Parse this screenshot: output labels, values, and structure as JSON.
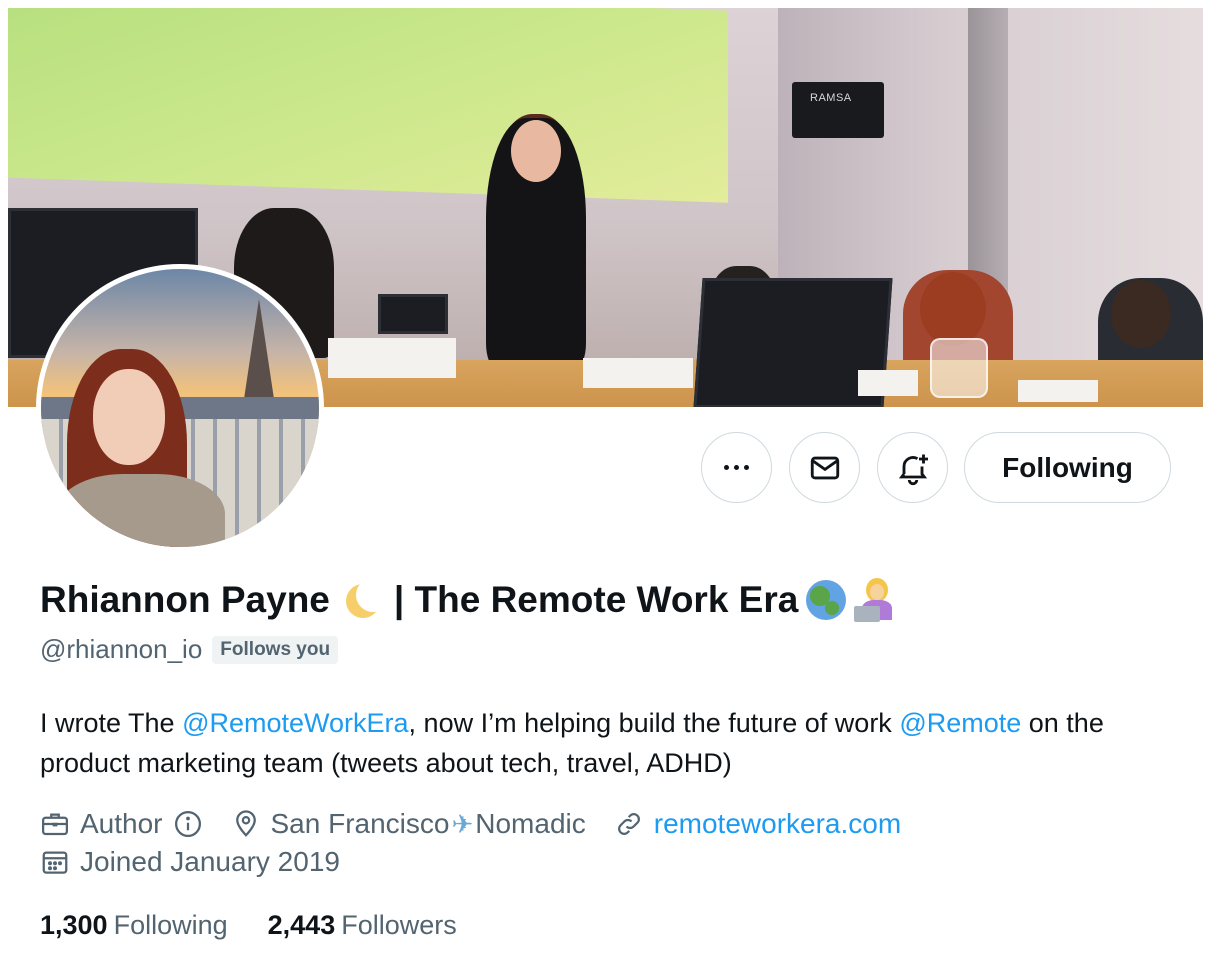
{
  "banner": {
    "speaker_brand": "RAMSA"
  },
  "actions": {
    "more_icon": "more-horizontal-icon",
    "message_icon": "envelope-icon",
    "notify_icon": "bell-plus-icon",
    "follow_label": "Following"
  },
  "profile": {
    "name": "Rhiannon Payne",
    "name_suffix": "| The Remote Work Era",
    "handle": "@rhiannon_io",
    "follows_you": "Follows you",
    "bio": {
      "part1": "I wrote The ",
      "mention1": "@RemoteWorkEra",
      "part2": ", now I’m helping build the future of work ",
      "mention2": "@Remote",
      "part3": " on the product marketing team (tweets about tech, travel, ADHD)"
    },
    "meta": {
      "category": "Author",
      "location_a": "San Francisco",
      "location_b": "Nomadic",
      "website": "remoteworkera.com",
      "joined": "Joined January 2019"
    }
  },
  "stats": {
    "following_count": "1,300",
    "following_label": "Following",
    "followers_count": "2,443",
    "followers_label": "Followers"
  },
  "colors": {
    "text_primary": "#0f1419",
    "text_secondary": "#536471",
    "link": "#1d9bf0",
    "border": "#cfd9de"
  }
}
